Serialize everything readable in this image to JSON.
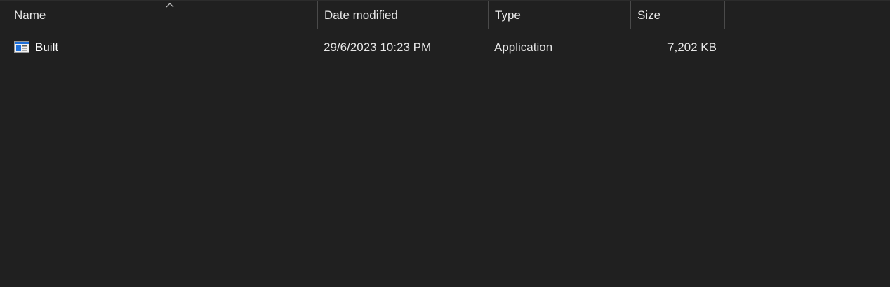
{
  "columns": {
    "name": "Name",
    "date_modified": "Date modified",
    "type": "Type",
    "size": "Size"
  },
  "sort": {
    "column": "name",
    "direction": "ascending",
    "icon": "chevron-up-icon"
  },
  "files": [
    {
      "name": "Built",
      "date_modified": "29/6/2023 10:23 PM",
      "type": "Application",
      "size": "7,202 KB",
      "icon": "application-icon"
    }
  ],
  "colors": {
    "background": "#202020",
    "text": "#ffffff",
    "divider": "#4a4a4a",
    "icon_accent": "#1e6fd9"
  }
}
